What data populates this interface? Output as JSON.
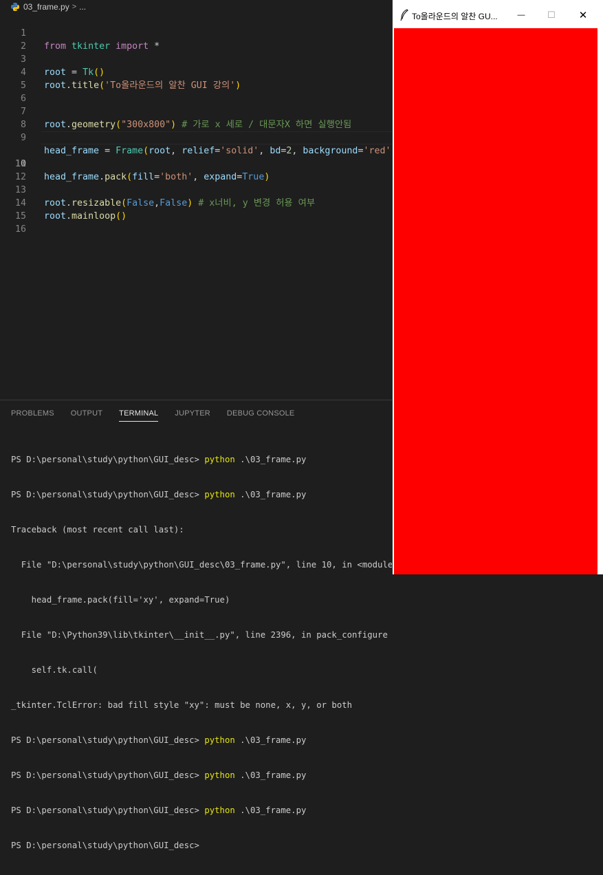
{
  "breadcrumb": {
    "file": "03_frame.py",
    "separator": ">",
    "more": "..."
  },
  "editor": {
    "current_line": 10,
    "lines": [
      {
        "n": "1"
      },
      {
        "n": "2"
      },
      {
        "n": "3"
      },
      {
        "n": "4"
      },
      {
        "n": "5"
      },
      {
        "n": "6"
      },
      {
        "n": "7"
      },
      {
        "n": "8"
      },
      {
        "n": "9"
      },
      {
        "n": "10"
      },
      {
        "n": "11"
      },
      {
        "n": "12"
      },
      {
        "n": "13"
      },
      {
        "n": "14"
      },
      {
        "n": "15"
      },
      {
        "n": "16"
      }
    ],
    "code": {
      "l1": [
        "from",
        "tkinter",
        "import",
        "*"
      ],
      "l3": [
        "root",
        " = ",
        "Tk",
        "(",
        ")"
      ],
      "l4": [
        "root",
        ".",
        "title",
        "(",
        "'To올라운드의 알찬 GUI 강의'",
        ")"
      ],
      "l7": [
        "root",
        ".",
        "geometry",
        "(",
        "\"300x800\"",
        ")",
        " # 가로 x 세로 / 대문자X 하면 실행안됨"
      ],
      "l9": [
        "head_frame",
        " = ",
        "Frame",
        "(",
        "root",
        ", ",
        "relief",
        "=",
        "'solid'",
        ", ",
        "bd",
        "=",
        "2",
        ", ",
        "background",
        "=",
        "'red'",
        ")"
      ],
      "l10": [
        "head_frame",
        ".",
        "pack",
        "(",
        "fill",
        "=",
        "'both'",
        ", ",
        "expand",
        "=",
        "True",
        ")"
      ],
      "l13": [
        "root",
        ".",
        "resizable",
        "(",
        "False",
        ",",
        "False",
        ")",
        " # x너비, y 변경 허용 여부"
      ],
      "l14": [
        "root",
        ".",
        "mainloop",
        "(",
        ")"
      ]
    }
  },
  "panel": {
    "tabs": [
      "PROBLEMS",
      "OUTPUT",
      "TERMINAL",
      "JUPYTER",
      "DEBUG CONSOLE"
    ],
    "active_tab": "TERMINAL",
    "terminal": {
      "prompt": "PS D:\\personal\\study\\python\\GUI_desc> ",
      "cmd": "python",
      "arg": " .\\03_frame.py",
      "trace": [
        "Traceback (most recent call last):",
        "  File \"D:\\personal\\study\\python\\GUI_desc\\03_frame.py\", line 10, in <module>",
        "    head_frame.pack(fill='xy', expand=True)",
        "  File \"D:\\Python39\\lib\\tkinter\\__init__.py\", line 2396, in pack_configure",
        "    self.tk.call(",
        "_tkinter.TclError: bad fill style \"xy\": must be none, x, y, or both"
      ],
      "last_prompt": "PS D:\\personal\\study\\python\\GUI_desc>"
    }
  },
  "tk_window": {
    "title": "To올라운드의 알찬 GU...",
    "minimize": "—",
    "maximize": "☐",
    "close": "✕",
    "frame_color": "#ff0000"
  },
  "colors": {
    "editor_bg": "#1e1e1e",
    "keyword": "#c586c0",
    "variable": "#9cdcfe",
    "class": "#4ec9b0",
    "function": "#dcdcaa",
    "string": "#ce9178",
    "comment": "#6a9955"
  }
}
